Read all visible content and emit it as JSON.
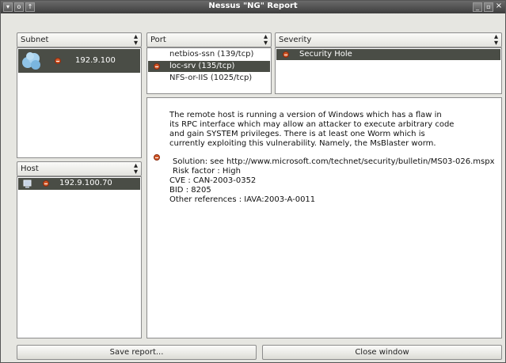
{
  "window": {
    "title": "Nessus \"NG\" Report",
    "left_controls": [
      "▾",
      "o",
      "↑"
    ],
    "right_controls": [
      "_",
      "▫",
      "×"
    ]
  },
  "subnet": {
    "label": "Subnet",
    "items": [
      {
        "text": "192.9.100",
        "icon": "cloud-icon"
      }
    ]
  },
  "host": {
    "label": "Host",
    "items": [
      {
        "text": "192.9.100.70",
        "icon": "computer-icon"
      }
    ]
  },
  "port": {
    "label": "Port",
    "items": [
      {
        "text": "netbios-ssn (139/tcp)",
        "selected": false
      },
      {
        "text": "loc-srv (135/tcp)",
        "selected": true
      },
      {
        "text": "NFS-or-IIS (1025/tcp)",
        "selected": false
      }
    ]
  },
  "severity": {
    "label": "Severity",
    "items": [
      {
        "text": "Security Hole",
        "selected": true
      }
    ]
  },
  "report": {
    "lines": [
      "The remote host is running a version of Windows which has a flaw in",
      "its RPC interface which may allow an attacker to execute arbitrary code",
      "and gain SYSTEM privileges.  There is at least one Worm which is",
      "currently exploiting this vulnerability.  Namely, the MsBlaster worm.",
      "Solution: see http://www.microsoft.com/technet/security/bulletin/MS03-026.mspx",
      "Risk factor : High",
      "CVE : CAN-2003-0352",
      "BID : 8205",
      "Other references : IAVA:2003-A-0011"
    ]
  },
  "buttons": {
    "save": "Save report...",
    "close": "Close window"
  },
  "colors": {
    "selection": "#4a4d46",
    "hole_icon": "#d45a2a",
    "titlebar": "#3d3d3d"
  }
}
